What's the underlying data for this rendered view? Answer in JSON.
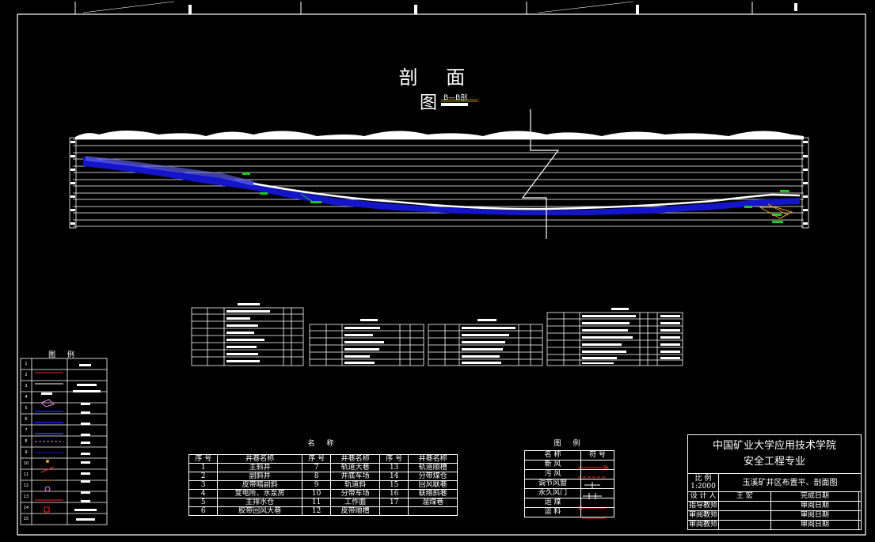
{
  "section": {
    "title": "剖 面",
    "title_line2": "图",
    "tag": "B—B剖"
  },
  "legend_left": {
    "title": "图 例",
    "rows": [
      "1",
      "2",
      "3",
      "4",
      "5",
      "6",
      "7",
      "8",
      "9",
      "10",
      "11",
      "12",
      "13",
      "14",
      "15"
    ]
  },
  "names_table": {
    "caption": "名 称",
    "headers": [
      "序 号",
      "井巷名称",
      "序 号",
      "井巷名称",
      "序 号",
      "井巷名称"
    ],
    "rows": [
      [
        "1",
        "主斜井",
        "7",
        "轨道大巷",
        "13",
        "轨道顺槽"
      ],
      [
        "2",
        "副斜井",
        "8",
        "井底车场",
        "14",
        "分带煤仓"
      ],
      [
        "3",
        "皮带暗副斜",
        "9",
        "轨道斜",
        "15",
        "回风联巷"
      ],
      [
        "4",
        "变电所、水泵房",
        "10",
        "分带车场",
        "16",
        "联络斜巷"
      ],
      [
        "5",
        "主排水仓",
        "11",
        "工作面",
        "17",
        "溜煤巷"
      ],
      [
        "6",
        "胶带回风大巷",
        "12",
        "皮带顺槽",
        "",
        ""
      ]
    ]
  },
  "legend_table": {
    "caption": "图 例",
    "headers": [
      "名 称",
      "符 号"
    ],
    "rows": [
      "新 风",
      "污 风",
      "调节风窗",
      "永久风门",
      "运 煤",
      "运 料"
    ]
  },
  "title_block": {
    "school": "中国矿业大学应用技术学院",
    "major": "安全工程专业",
    "scale_label": "比 例",
    "scale": "1:2000",
    "drawing": "玉溪矿井区布置平、剖面图",
    "row1": [
      "设 计 人",
      "王 宏",
      "完成日期"
    ],
    "row2": [
      "指导教师",
      "",
      "审阅日期"
    ],
    "row3": [
      "审阅教师",
      "",
      "审阅日期"
    ],
    "row4": [
      "审阅教师",
      "",
      "审阅日期"
    ]
  },
  "colors": {
    "seam": "#1414c8",
    "roadway": "#ffffff",
    "marker": "#19c81e",
    "accent": "#ff2020",
    "frame": "#ffffff"
  }
}
